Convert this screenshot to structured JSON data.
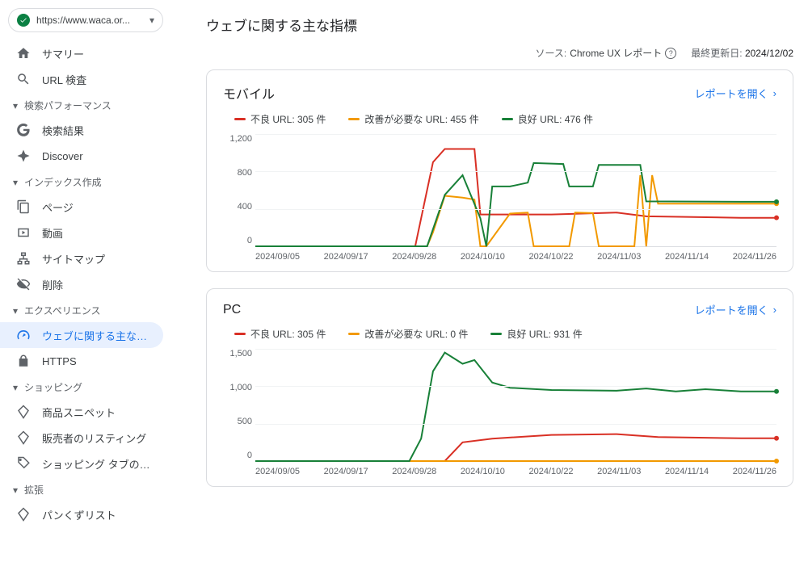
{
  "property": {
    "url": "https://www.waca.or..."
  },
  "nav": {
    "summary": "サマリー",
    "url_inspect": "URL 検査",
    "section_search": "検索パフォーマンス",
    "search_results": "検索結果",
    "discover": "Discover",
    "section_index": "インデックス作成",
    "pages": "ページ",
    "video": "動画",
    "sitemap": "サイトマップ",
    "removal": "削除",
    "section_experience": "エクスペリエンス",
    "cwv": "ウェブに関する主な指標",
    "https": "HTTPS",
    "section_shopping": "ショッピング",
    "snippet": "商品スニペット",
    "merchant": "販売者のリスティング",
    "shopping_tab": "ショッピング タブのリス...",
    "section_ext": "拡張",
    "breadcrumb": "パンくずリスト"
  },
  "header": {
    "title": "ウェブに関する主な指標",
    "source_label": "ソース:",
    "source_value": "Chrome UX レポート",
    "updated_label": "最終更新日:",
    "updated_value": "2024/12/02"
  },
  "open_report": "レポートを開く",
  "colors": {
    "poor": "#d93025",
    "ni": "#f29900",
    "good": "#188038"
  },
  "cards": [
    {
      "title": "モバイル",
      "legend": [
        "不良 URL: 305 件",
        "改善が必要な URL: 455 件",
        "良好 URL: 476 件"
      ]
    },
    {
      "title": "PC",
      "legend": [
        "不良 URL: 305 件",
        "改善が必要な URL: 0 件",
        "良好 URL: 931 件"
      ]
    }
  ],
  "chart_data": [
    {
      "type": "line",
      "title": "モバイル",
      "ylim": [
        0,
        1200
      ],
      "yticks": [
        0,
        400,
        800,
        1200
      ],
      "x_labels": [
        "2024/09/05",
        "2024/09/17",
        "2024/09/28",
        "2024/10/10",
        "2024/10/22",
        "2024/11/03",
        "2024/11/14",
        "2024/11/26"
      ],
      "x_start": "2024/09/05",
      "x_end": "2024/12/02",
      "series": [
        {
          "name": "poor",
          "points": [
            [
              "2024/09/05",
              0
            ],
            [
              "2024/10/02",
              0
            ],
            [
              "2024/10/03",
              300
            ],
            [
              "2024/10/05",
              900
            ],
            [
              "2024/10/07",
              1040
            ],
            [
              "2024/10/12",
              1040
            ],
            [
              "2024/10/13",
              340
            ],
            [
              "2024/10/20",
              340
            ],
            [
              "2024/10/25",
              340
            ],
            [
              "2024/11/05",
              360
            ],
            [
              "2024/11/10",
              320
            ],
            [
              "2024/11/26",
              305
            ],
            [
              "2024/12/02",
              305
            ]
          ]
        },
        {
          "name": "ni",
          "points": [
            [
              "2024/09/05",
              0
            ],
            [
              "2024/10/04",
              0
            ],
            [
              "2024/10/05",
              150
            ],
            [
              "2024/10/07",
              540
            ],
            [
              "2024/10/10",
              520
            ],
            [
              "2024/10/12",
              500
            ],
            [
              "2024/10/13",
              0
            ],
            [
              "2024/10/14",
              0
            ],
            [
              "2024/10/18",
              350
            ],
            [
              "2024/10/21",
              360
            ],
            [
              "2024/10/22",
              0
            ],
            [
              "2024/10/28",
              0
            ],
            [
              "2024/10/29",
              360
            ],
            [
              "2024/11/01",
              355
            ],
            [
              "2024/11/02",
              0
            ],
            [
              "2024/11/08",
              0
            ],
            [
              "2024/11/09",
              760
            ],
            [
              "2024/11/10",
              0
            ],
            [
              "2024/11/11",
              760
            ],
            [
              "2024/11/12",
              455
            ],
            [
              "2024/12/02",
              455
            ]
          ]
        },
        {
          "name": "good",
          "points": [
            [
              "2024/09/05",
              0
            ],
            [
              "2024/10/04",
              0
            ],
            [
              "2024/10/07",
              550
            ],
            [
              "2024/10/10",
              760
            ],
            [
              "2024/10/13",
              300
            ],
            [
              "2024/10/14",
              0
            ],
            [
              "2024/10/15",
              640
            ],
            [
              "2024/10/17",
              640
            ],
            [
              "2024/10/18",
              640
            ],
            [
              "2024/10/21",
              680
            ],
            [
              "2024/10/22",
              890
            ],
            [
              "2024/10/27",
              880
            ],
            [
              "2024/10/28",
              640
            ],
            [
              "2024/10/29",
              640
            ],
            [
              "2024/11/01",
              640
            ],
            [
              "2024/11/02",
              870
            ],
            [
              "2024/11/07",
              870
            ],
            [
              "2024/11/08",
              870
            ],
            [
              "2024/11/09",
              870
            ],
            [
              "2024/11/10",
              480
            ],
            [
              "2024/11/26",
              476
            ],
            [
              "2024/12/02",
              476
            ]
          ]
        }
      ]
    },
    {
      "type": "line",
      "title": "PC",
      "ylim": [
        0,
        1500
      ],
      "yticks": [
        0,
        500,
        1000,
        1500
      ],
      "x_labels": [
        "2024/09/05",
        "2024/09/17",
        "2024/09/28",
        "2024/10/10",
        "2024/10/22",
        "2024/11/03",
        "2024/11/14",
        "2024/11/26"
      ],
      "x_start": "2024/09/05",
      "x_end": "2024/12/02",
      "series": [
        {
          "name": "poor",
          "points": [
            [
              "2024/09/05",
              0
            ],
            [
              "2024/10/07",
              0
            ],
            [
              "2024/10/10",
              250
            ],
            [
              "2024/10/15",
              300
            ],
            [
              "2024/10/25",
              350
            ],
            [
              "2024/11/05",
              360
            ],
            [
              "2024/11/12",
              320
            ],
            [
              "2024/11/26",
              305
            ],
            [
              "2024/12/02",
              305
            ]
          ]
        },
        {
          "name": "ni",
          "points": [
            [
              "2024/09/05",
              0
            ],
            [
              "2024/12/02",
              0
            ]
          ]
        },
        {
          "name": "good",
          "points": [
            [
              "2024/09/05",
              0
            ],
            [
              "2024/10/01",
              0
            ],
            [
              "2024/10/03",
              300
            ],
            [
              "2024/10/05",
              1200
            ],
            [
              "2024/10/07",
              1450
            ],
            [
              "2024/10/10",
              1300
            ],
            [
              "2024/10/12",
              1350
            ],
            [
              "2024/10/15",
              1050
            ],
            [
              "2024/10/18",
              980
            ],
            [
              "2024/10/25",
              950
            ],
            [
              "2024/11/05",
              940
            ],
            [
              "2024/11/10",
              970
            ],
            [
              "2024/11/15",
              930
            ],
            [
              "2024/11/20",
              960
            ],
            [
              "2024/11/26",
              931
            ],
            [
              "2024/12/02",
              931
            ]
          ]
        }
      ]
    }
  ]
}
